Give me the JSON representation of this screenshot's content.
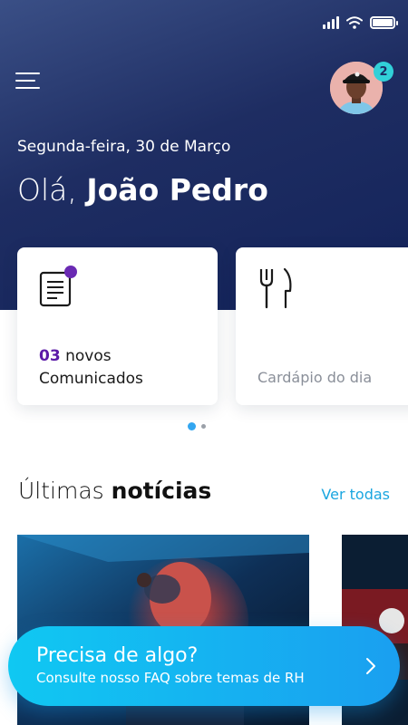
{
  "header": {
    "date": "Segunda-feira, 30 de Março",
    "greeting_prefix": "Olá,",
    "user_name": "João Pedro",
    "notification_count": "2"
  },
  "cards": [
    {
      "count": "03",
      "label_line1": "novos",
      "label_line2": "Comunicados",
      "icon": "document-icon",
      "has_unread_dot": true
    },
    {
      "label": "Cardápio do dia",
      "icon": "fork-knife-icon"
    }
  ],
  "news": {
    "title_light": "Últimas",
    "title_bold": "notícias",
    "see_all": "Ver todas"
  },
  "help": {
    "title": "Precisa de algo?",
    "subtitle": "Consulte nosso FAQ sobre temas de RH",
    "icon": "chevron-right-icon"
  },
  "colors": {
    "header_bg": "#1e2d62",
    "accent_purple": "#5b1aa7",
    "accent_blue": "#1aa6e0",
    "badge": "#31d0d8"
  }
}
